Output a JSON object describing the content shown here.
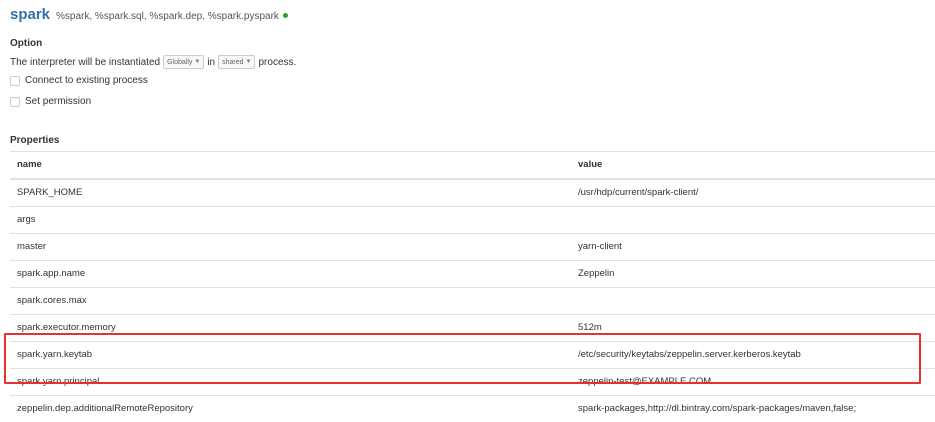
{
  "interpreter": {
    "name": "spark",
    "bindings": "%spark, %spark.sql, %spark.dep, %spark.pyspark",
    "status_color": "#2ca02c"
  },
  "option": {
    "heading": "Option",
    "instantiated_prefix": "The interpreter will be instantiated",
    "scope_select": "Globally",
    "in_text": "in",
    "mode_select": "shared",
    "process_text": "process.",
    "connect_existing": "Connect to existing process",
    "set_permission": "Set permission"
  },
  "properties": {
    "heading": "Properties",
    "columns": [
      "name",
      "value"
    ],
    "rows": [
      {
        "name": "SPARK_HOME",
        "value": "/usr/hdp/current/spark-client/"
      },
      {
        "name": "args",
        "value": ""
      },
      {
        "name": "master",
        "value": "yarn-client"
      },
      {
        "name": "spark.app.name",
        "value": "Zeppelin"
      },
      {
        "name": "spark.cores.max",
        "value": ""
      },
      {
        "name": "spark.executor.memory",
        "value": "512m"
      },
      {
        "name": "spark.yarn.keytab",
        "value": "/etc/security/keytabs/zeppelin.server.kerberos.keytab"
      },
      {
        "name": "spark.yarn.principal",
        "value": "zeppelin-test@EXAMPLE.COM"
      },
      {
        "name": "zeppelin.dep.additionalRemoteRepository",
        "value": "spark-packages,http://dl.bintray.com/spark-packages/maven,false;"
      }
    ]
  },
  "colors": {
    "title": "#3071a9",
    "highlight": "#e83030"
  }
}
